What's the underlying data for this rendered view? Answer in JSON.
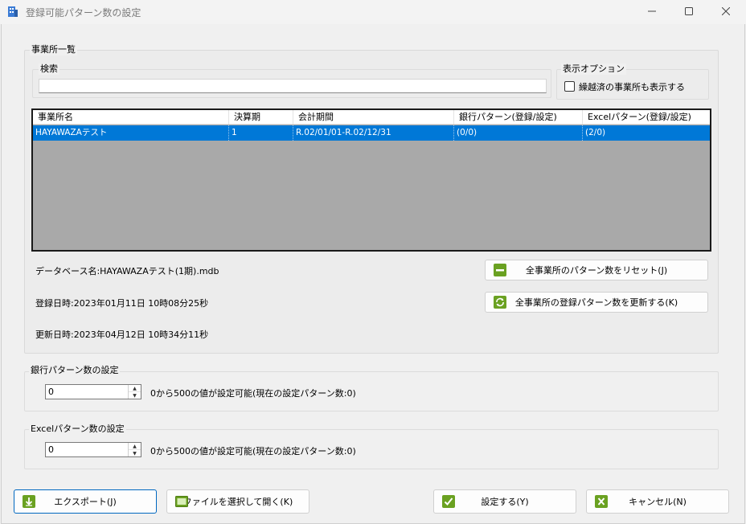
{
  "window": {
    "title": "登録可能パターン数の設定"
  },
  "office_group": {
    "legend": "事業所一覧",
    "search": {
      "legend": "検索",
      "value": ""
    },
    "display_option": {
      "legend": "表示オプション",
      "checkbox_label": "繰越済の事業所も表示する",
      "checked": false
    },
    "table": {
      "columns": [
        "事業所名",
        "決算期",
        "会計期間",
        "銀行パターン(登録/設定)",
        "Excelパターン(登録/設定)"
      ],
      "rows": [
        {
          "office_name": "HAYAWAZAテスト",
          "fiscal_period": "1",
          "accounting_period": "R.02/01/01-R.02/12/31",
          "bank_pattern": "(0/0)",
          "excel_pattern": "(2/0)",
          "selected": true
        }
      ]
    },
    "db_name_text": "データベース名:HAYAWAZAテスト(1期).mdb",
    "registered_text": "登録日時:2023年01月11日 10時08分25秒",
    "updated_text": "更新日時:2023年04月12日 10時34分11秒",
    "reset_button": "全事業所のパターン数をリセット(J)",
    "update_button": "全事業所の登録パターン数を更新する(K)"
  },
  "bank_group": {
    "legend": "銀行パターン数の設定",
    "value": "0",
    "hint": "0から500の値が設定可能(現在の設定パターン数:0)"
  },
  "excel_group": {
    "legend": "Excelパターン数の設定",
    "value": "0",
    "hint": "0から500の値が設定可能(現在の設定パターン数:0)"
  },
  "footer": {
    "export_button": "エクスポート(J)",
    "open_file_button": "ファイルを選択して開く(K)",
    "apply_button": "設定する(Y)",
    "cancel_button": "キャンセル(N)"
  },
  "colors": {
    "selection": "#0078d7",
    "list_background": "#a9a9a9",
    "accent_border": "#0067c0",
    "icon_green": "#6aa121"
  },
  "icons": {
    "app": "building-icon",
    "reset": "minus-icon",
    "update": "refresh-icon",
    "export": "download-arrow-icon",
    "open_file": "open-file-icon",
    "apply": "checkmark-icon",
    "cancel": "x-mark-icon"
  }
}
